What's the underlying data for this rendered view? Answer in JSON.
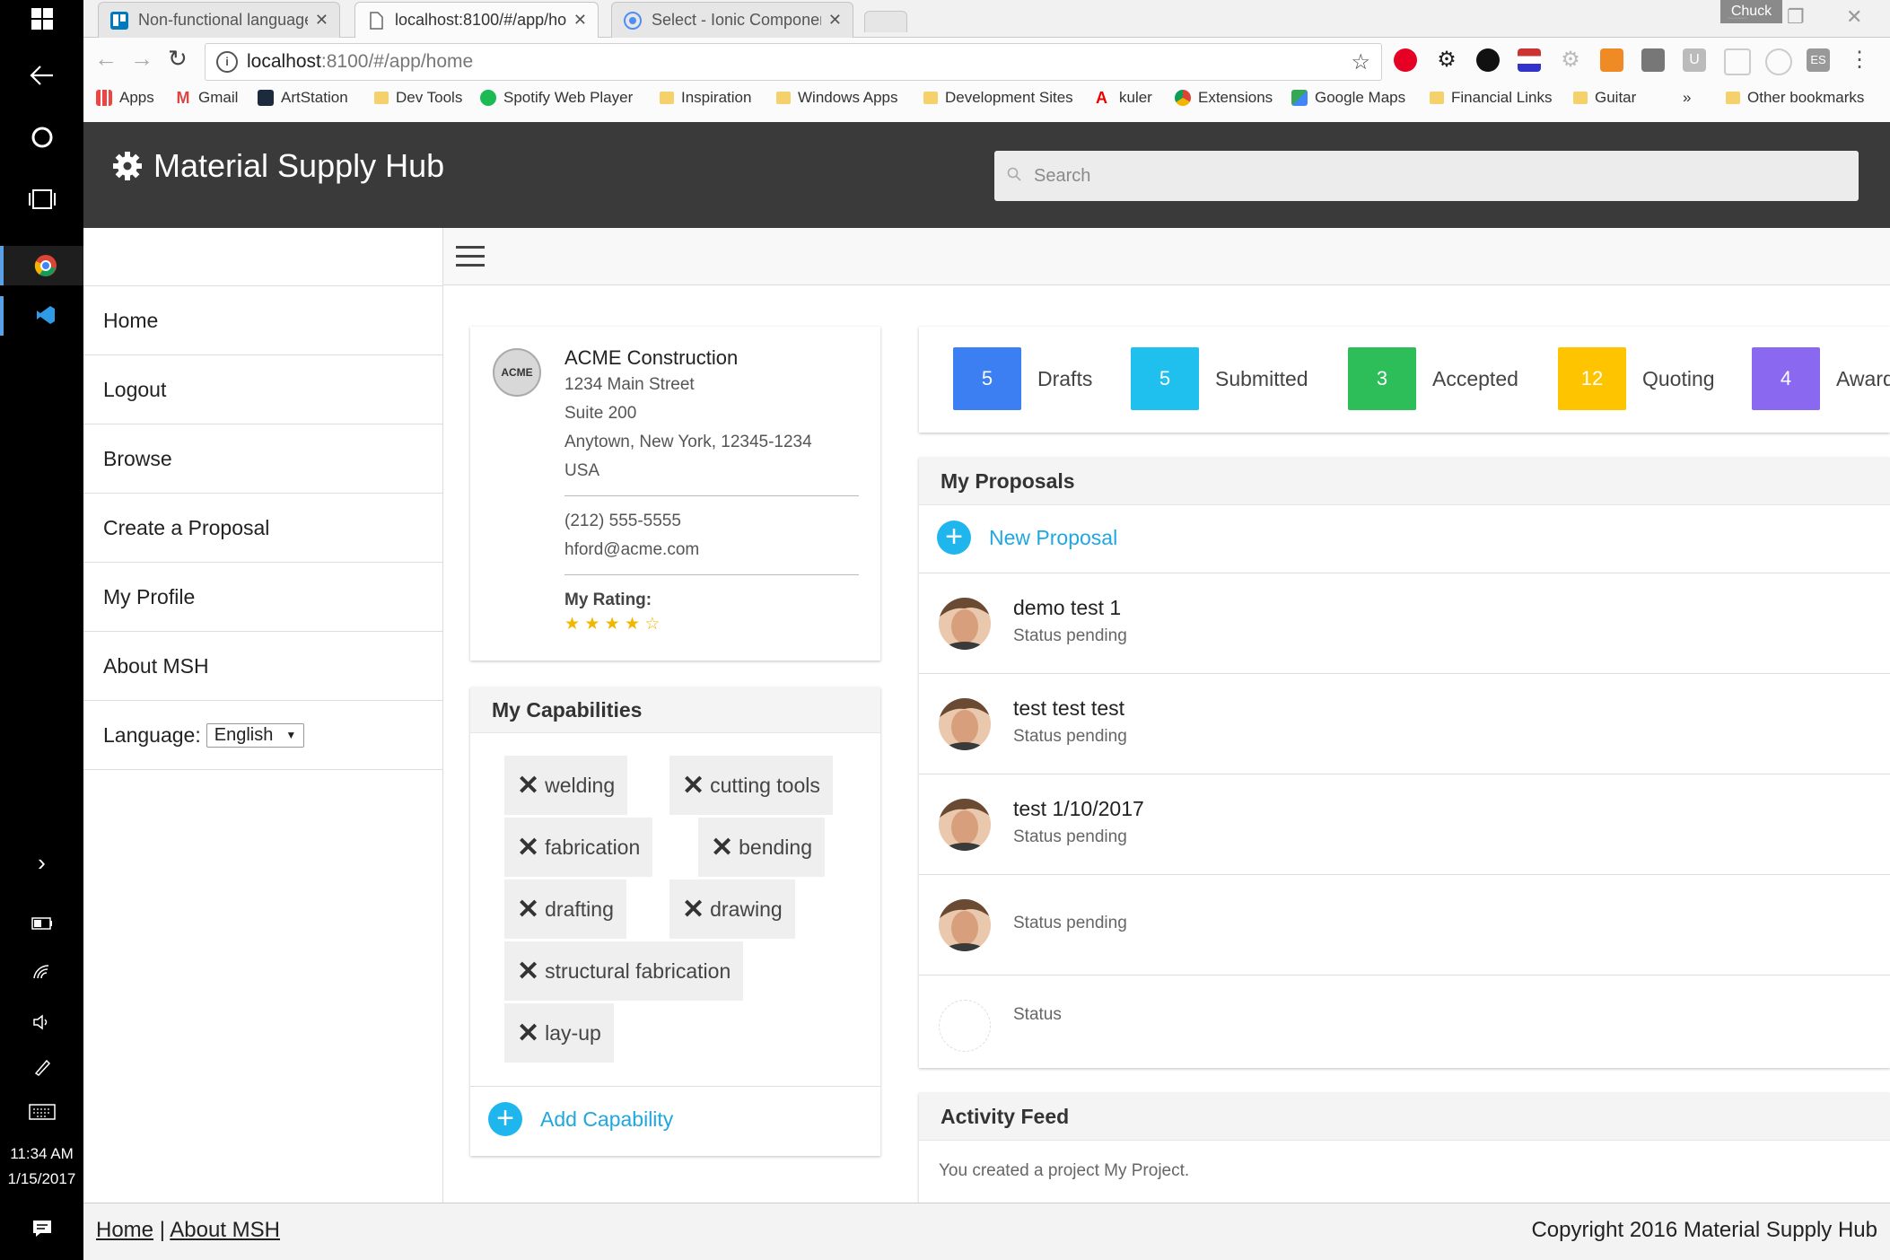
{
  "taskbar": {
    "clock_time": "11:34 AM",
    "clock_date": "1/15/2017"
  },
  "browser": {
    "tabs": [
      {
        "title": "Non-functional language",
        "active": false
      },
      {
        "title": "localhost:8100/#/app/ho",
        "active": true
      },
      {
        "title": "Select - Ionic Componen",
        "active": false
      }
    ],
    "user_badge": "Chuck",
    "url_host": "localhost",
    "url_rest": ":8100/#/app/home",
    "bookmarks": [
      {
        "label": "Apps",
        "icon": "apps-grid-icon"
      },
      {
        "label": "Gmail",
        "icon": "gmail-icon"
      },
      {
        "label": "ArtStation",
        "icon": "artstation-icon"
      },
      {
        "label": "Dev Tools",
        "icon": "folder-icon"
      },
      {
        "label": "Spotify Web Player",
        "icon": "spotify-icon"
      },
      {
        "label": "Inspiration",
        "icon": "folder-icon"
      },
      {
        "label": "Windows Apps",
        "icon": "folder-icon"
      },
      {
        "label": "Development Sites",
        "icon": "folder-icon"
      },
      {
        "label": "kuler",
        "icon": "adobe-icon"
      },
      {
        "label": "Extensions",
        "icon": "extensions-icon"
      },
      {
        "label": "Google Maps",
        "icon": "maps-icon"
      },
      {
        "label": "Financial Links",
        "icon": "folder-icon"
      },
      {
        "label": "Guitar",
        "icon": "folder-icon"
      }
    ],
    "bookmarks_overflow": "»",
    "other_bookmarks": "Other bookmarks"
  },
  "app": {
    "title": "Material Supply Hub",
    "search_placeholder": "Search"
  },
  "sidebar": {
    "items": [
      {
        "label": "Home"
      },
      {
        "label": "Logout"
      },
      {
        "label": "Browse"
      },
      {
        "label": "Create a Proposal"
      },
      {
        "label": "My Profile"
      },
      {
        "label": "About MSH"
      }
    ],
    "language_label": "Language:",
    "language_value": "English"
  },
  "company": {
    "logo_text": "ACME",
    "name": "ACME Construction",
    "address1": "1234 Main Street",
    "address2": "Suite 200",
    "city_line": "Anytown, New York, 12345-1234",
    "country": "USA",
    "phone": "(212) 555-5555",
    "email": "hford@acme.com",
    "rating_label": "My Rating:",
    "rating_value": 4,
    "rating_max": 5
  },
  "capabilities": {
    "header": "My Capabilities",
    "items": [
      "welding",
      "cutting tools",
      "fabrication",
      "bending",
      "drafting",
      "drawing",
      "structural fabrication",
      "lay-up"
    ],
    "add_label": "Add Capability"
  },
  "stats": [
    {
      "count": "5",
      "label": "Drafts",
      "color": "#3b7ff2"
    },
    {
      "count": "5",
      "label": "Submitted",
      "color": "#1fc0ee"
    },
    {
      "count": "3",
      "label": "Accepted",
      "color": "#2dbe5a"
    },
    {
      "count": "12",
      "label": "Quoting",
      "color": "#ffc400"
    },
    {
      "count": "4",
      "label": "Award",
      "color": "#8b68f0"
    }
  ],
  "proposals": {
    "header": "My Proposals",
    "new_label": "New Proposal",
    "items": [
      {
        "title": "demo test 1",
        "status": "Status pending"
      },
      {
        "title": "test test test",
        "status": "Status pending"
      },
      {
        "title": "test 1/10/2017",
        "status": "Status pending"
      },
      {
        "title": "",
        "status": "Status pending"
      },
      {
        "title": "",
        "status": "Status"
      }
    ]
  },
  "activity": {
    "header": "Activity Feed",
    "items": [
      "You created a project My Project."
    ]
  },
  "footer": {
    "home_link": "Home",
    "separator": "|",
    "about_link": "About MSH",
    "copyright": "Copyright 2016 Material Supply Hub"
  }
}
